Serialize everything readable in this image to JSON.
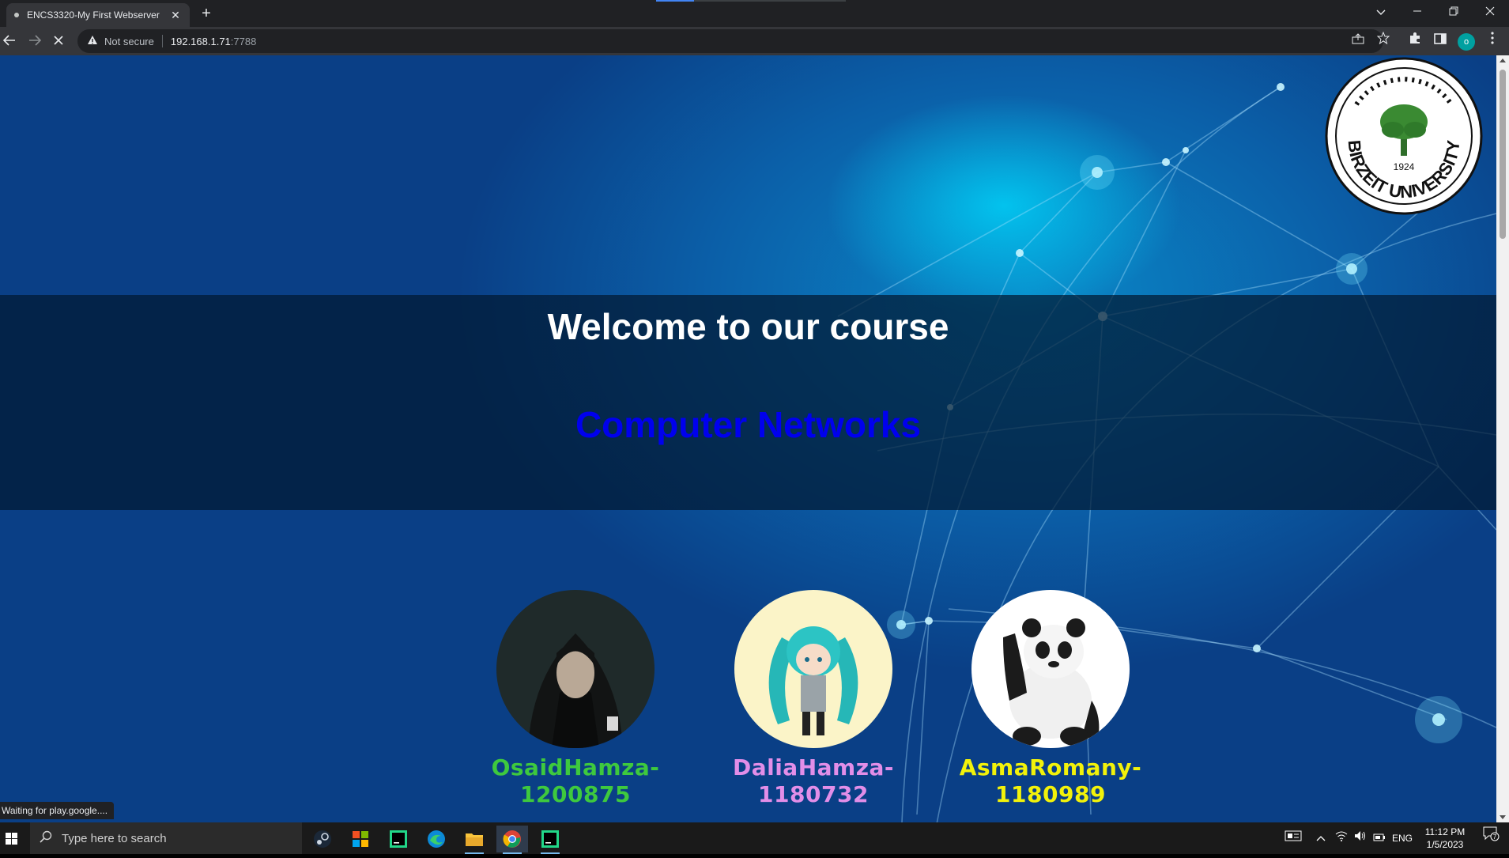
{
  "browser": {
    "tab_title": "ENCS3320-My First Webserver",
    "tab_close": "✕",
    "new_tab": "+",
    "security_label": "Not secure",
    "url_host": "192.168.1.71",
    "url_port": ":7788",
    "profile_initial": "o",
    "status_text": "Waiting for play.google...."
  },
  "page": {
    "heading": "Welcome to our course",
    "course": "Computer Networks",
    "logo": {
      "year": "1924",
      "ring_text": "BIRZEIT UNIVERSITY"
    },
    "members": [
      {
        "name": "OsaidHamza-",
        "id": "1200875",
        "color": "#3ec93e"
      },
      {
        "name": "DaliaHamza-",
        "id": "1180732",
        "color": "#e28ee8"
      },
      {
        "name": "AsmaRomany-",
        "id": "1180989",
        "color": "#f2f20a"
      }
    ]
  },
  "taskbar": {
    "search_placeholder": "Type here to search",
    "language": "ENG",
    "time": "11:12 PM",
    "date": "1/5/2023",
    "notification_count": "7"
  },
  "colors": {
    "chrome_dark": "#202124",
    "chrome_toolbar": "#35363a",
    "band": "#021932",
    "course_link": "#0000ee"
  }
}
